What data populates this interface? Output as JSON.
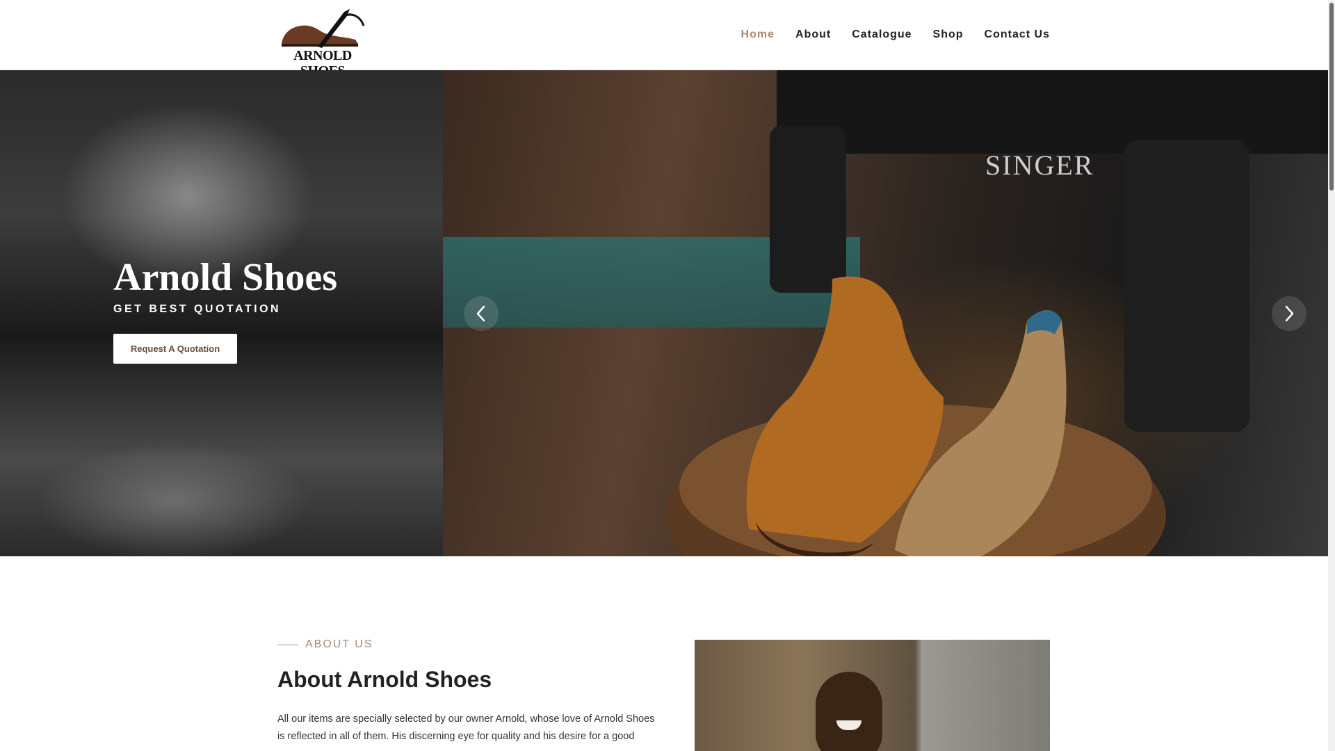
{
  "header": {
    "logo": {
      "text": "ARNOLD SHOES",
      "brand_color": "#6b3a22"
    },
    "nav": [
      {
        "label": "Home",
        "active": true
      },
      {
        "label": "About",
        "active": false
      },
      {
        "label": "Catalogue",
        "active": false
      },
      {
        "label": "Shop",
        "active": false
      },
      {
        "label": "Contact Us",
        "active": false
      }
    ]
  },
  "hero": {
    "title": "Arnold Shoes",
    "subtitle": "GET BEST QUOTATION",
    "cta_label": "Request A Quotation",
    "prev_icon": "chevron-left-icon",
    "next_icon": "chevron-right-icon"
  },
  "about": {
    "eyebrow": "ABOUT US",
    "title": "About Arnold Shoes",
    "body": "All our items are specially selected by our owner Arnold, whose love of Arnold Shoes is reflected in all of them. His discerning eye for quality and his desire for a good"
  },
  "colors": {
    "accent": "#a88a72",
    "button_text": "#6d4c3a",
    "text_dark": "#222222"
  }
}
